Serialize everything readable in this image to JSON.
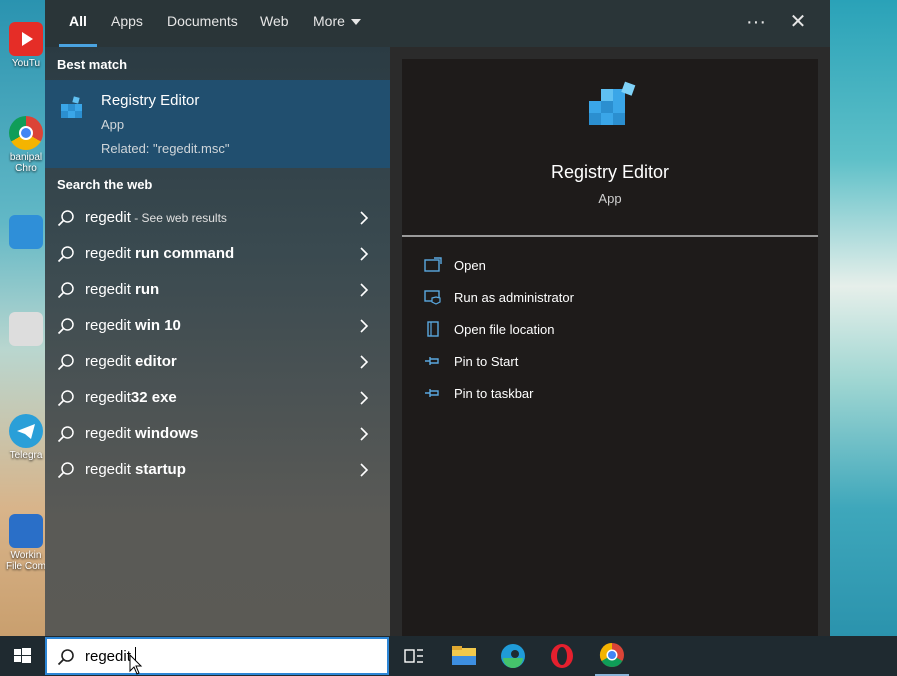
{
  "desktop": {
    "icons": [
      {
        "label": "YouTu",
        "icon": "youtube-icon",
        "color": "#e52d27"
      },
      {
        "label": "banipal\nChro",
        "icon": "chrome-icon",
        "color": "#db4437"
      },
      {
        "label": "",
        "icon": "presentation-icon",
        "color": "#2f8fd8"
      },
      {
        "label": "",
        "icon": "document-icon",
        "color": "#dddddd"
      },
      {
        "label": "Telegra",
        "icon": "telegram-icon",
        "color": "#2a9fd8"
      },
      {
        "label": "Workin\nFile Com",
        "icon": "zip-archive-icon",
        "color": "#2a6fc8"
      }
    ]
  },
  "tabs": [
    {
      "label": "All",
      "active": true
    },
    {
      "label": "Apps",
      "active": false
    },
    {
      "label": "Documents",
      "active": false
    },
    {
      "label": "Web",
      "active": false
    },
    {
      "label": "More",
      "active": false
    }
  ],
  "top_buttons": {
    "options": "···",
    "close": "✕"
  },
  "best_match": {
    "section": "Best match",
    "title": "Registry Editor",
    "type": "App",
    "related": "Related: \"regedit.msc\"",
    "icon": "registry-editor-icon"
  },
  "web": {
    "section": "Search the web",
    "items": [
      {
        "prefix": "regedit",
        "suffix": "",
        "hint": " - See web results"
      },
      {
        "prefix": "regedit ",
        "suffix": "run command",
        "hint": ""
      },
      {
        "prefix": "regedit ",
        "suffix": "run",
        "hint": ""
      },
      {
        "prefix": "regedit ",
        "suffix": "win 10",
        "hint": ""
      },
      {
        "prefix": "regedit ",
        "suffix": "editor",
        "hint": ""
      },
      {
        "prefix": "regedit",
        "suffix": "32 exe",
        "hint": ""
      },
      {
        "prefix": "regedit ",
        "suffix": "windows",
        "hint": ""
      },
      {
        "prefix": "regedit ",
        "suffix": "startup",
        "hint": ""
      }
    ]
  },
  "preview": {
    "title": "Registry Editor",
    "type": "App",
    "actions": [
      {
        "label": "Open",
        "icon": "open-window-icon"
      },
      {
        "label": "Run as administrator",
        "icon": "shield-icon"
      },
      {
        "label": "Open file location",
        "icon": "file-location-icon"
      },
      {
        "label": "Pin to Start",
        "icon": "pin-icon"
      },
      {
        "label": "Pin to taskbar",
        "icon": "pin-icon"
      }
    ]
  },
  "taskbar": {
    "search_value": "regedit",
    "apps": [
      "task-view-icon",
      "file-explorer-icon",
      "edge-icon",
      "opera-icon",
      "chrome-icon"
    ]
  },
  "colors": {
    "accent": "#4aa3e0",
    "best_match_bg": "#214f6f",
    "preview_bg": "#1e1b1a",
    "search_border": "#2d86d6"
  }
}
